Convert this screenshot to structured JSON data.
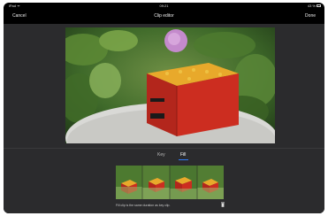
{
  "status_bar": {
    "carrier": "iPad ᯤ",
    "time": "09:21",
    "battery": "43 %"
  },
  "nav": {
    "cancel_label": "Cancel",
    "title": "Clip editor",
    "done_label": "Done"
  },
  "mode_tabs": [
    {
      "label": "Key",
      "selected": false
    },
    {
      "label": "Fill",
      "selected": true
    }
  ],
  "filmstrip": {
    "frames": 4
  },
  "hint": "Fill clip is the same duration as key clip.",
  "colors": {
    "accent": "#2f7bf5",
    "background": "#2b2b2d"
  },
  "icons": {
    "trash": "trash-icon",
    "battery": "battery-icon",
    "wifi": "wifi-icon"
  }
}
